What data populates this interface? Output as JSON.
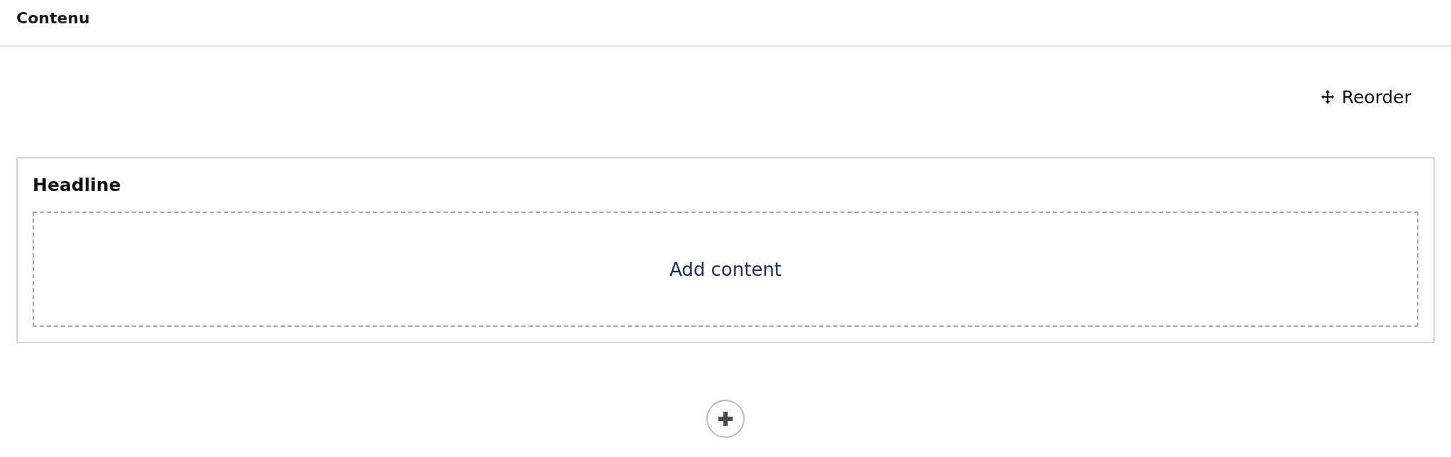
{
  "header": {
    "title": "Contenu"
  },
  "toolbar": {
    "reorder_button": "Reorder"
  },
  "block": {
    "title": "Headline",
    "placeholder_action": "Add content"
  }
}
